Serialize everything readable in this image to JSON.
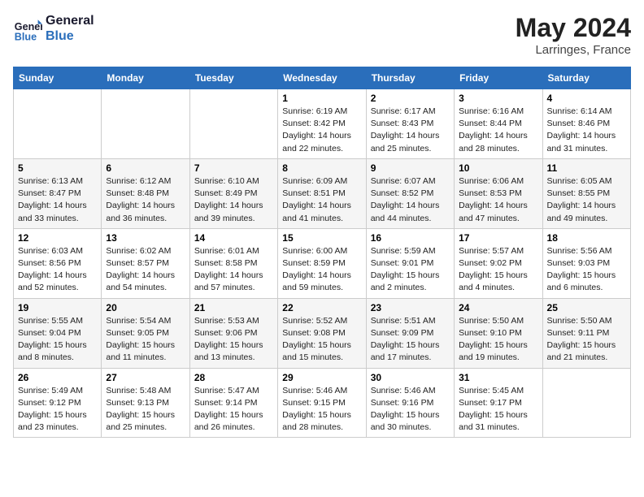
{
  "header": {
    "logo_line1": "General",
    "logo_line2": "Blue",
    "month_year": "May 2024",
    "location": "Larringes, France"
  },
  "weekdays": [
    "Sunday",
    "Monday",
    "Tuesday",
    "Wednesday",
    "Thursday",
    "Friday",
    "Saturday"
  ],
  "weeks": [
    [
      {
        "day": "",
        "info": ""
      },
      {
        "day": "",
        "info": ""
      },
      {
        "day": "",
        "info": ""
      },
      {
        "day": "1",
        "info": "Sunrise: 6:19 AM\nSunset: 8:42 PM\nDaylight: 14 hours\nand 22 minutes."
      },
      {
        "day": "2",
        "info": "Sunrise: 6:17 AM\nSunset: 8:43 PM\nDaylight: 14 hours\nand 25 minutes."
      },
      {
        "day": "3",
        "info": "Sunrise: 6:16 AM\nSunset: 8:44 PM\nDaylight: 14 hours\nand 28 minutes."
      },
      {
        "day": "4",
        "info": "Sunrise: 6:14 AM\nSunset: 8:46 PM\nDaylight: 14 hours\nand 31 minutes."
      }
    ],
    [
      {
        "day": "5",
        "info": "Sunrise: 6:13 AM\nSunset: 8:47 PM\nDaylight: 14 hours\nand 33 minutes."
      },
      {
        "day": "6",
        "info": "Sunrise: 6:12 AM\nSunset: 8:48 PM\nDaylight: 14 hours\nand 36 minutes."
      },
      {
        "day": "7",
        "info": "Sunrise: 6:10 AM\nSunset: 8:49 PM\nDaylight: 14 hours\nand 39 minutes."
      },
      {
        "day": "8",
        "info": "Sunrise: 6:09 AM\nSunset: 8:51 PM\nDaylight: 14 hours\nand 41 minutes."
      },
      {
        "day": "9",
        "info": "Sunrise: 6:07 AM\nSunset: 8:52 PM\nDaylight: 14 hours\nand 44 minutes."
      },
      {
        "day": "10",
        "info": "Sunrise: 6:06 AM\nSunset: 8:53 PM\nDaylight: 14 hours\nand 47 minutes."
      },
      {
        "day": "11",
        "info": "Sunrise: 6:05 AM\nSunset: 8:55 PM\nDaylight: 14 hours\nand 49 minutes."
      }
    ],
    [
      {
        "day": "12",
        "info": "Sunrise: 6:03 AM\nSunset: 8:56 PM\nDaylight: 14 hours\nand 52 minutes."
      },
      {
        "day": "13",
        "info": "Sunrise: 6:02 AM\nSunset: 8:57 PM\nDaylight: 14 hours\nand 54 minutes."
      },
      {
        "day": "14",
        "info": "Sunrise: 6:01 AM\nSunset: 8:58 PM\nDaylight: 14 hours\nand 57 minutes."
      },
      {
        "day": "15",
        "info": "Sunrise: 6:00 AM\nSunset: 8:59 PM\nDaylight: 14 hours\nand 59 minutes."
      },
      {
        "day": "16",
        "info": "Sunrise: 5:59 AM\nSunset: 9:01 PM\nDaylight: 15 hours\nand 2 minutes."
      },
      {
        "day": "17",
        "info": "Sunrise: 5:57 AM\nSunset: 9:02 PM\nDaylight: 15 hours\nand 4 minutes."
      },
      {
        "day": "18",
        "info": "Sunrise: 5:56 AM\nSunset: 9:03 PM\nDaylight: 15 hours\nand 6 minutes."
      }
    ],
    [
      {
        "day": "19",
        "info": "Sunrise: 5:55 AM\nSunset: 9:04 PM\nDaylight: 15 hours\nand 8 minutes."
      },
      {
        "day": "20",
        "info": "Sunrise: 5:54 AM\nSunset: 9:05 PM\nDaylight: 15 hours\nand 11 minutes."
      },
      {
        "day": "21",
        "info": "Sunrise: 5:53 AM\nSunset: 9:06 PM\nDaylight: 15 hours\nand 13 minutes."
      },
      {
        "day": "22",
        "info": "Sunrise: 5:52 AM\nSunset: 9:08 PM\nDaylight: 15 hours\nand 15 minutes."
      },
      {
        "day": "23",
        "info": "Sunrise: 5:51 AM\nSunset: 9:09 PM\nDaylight: 15 hours\nand 17 minutes."
      },
      {
        "day": "24",
        "info": "Sunrise: 5:50 AM\nSunset: 9:10 PM\nDaylight: 15 hours\nand 19 minutes."
      },
      {
        "day": "25",
        "info": "Sunrise: 5:50 AM\nSunset: 9:11 PM\nDaylight: 15 hours\nand 21 minutes."
      }
    ],
    [
      {
        "day": "26",
        "info": "Sunrise: 5:49 AM\nSunset: 9:12 PM\nDaylight: 15 hours\nand 23 minutes."
      },
      {
        "day": "27",
        "info": "Sunrise: 5:48 AM\nSunset: 9:13 PM\nDaylight: 15 hours\nand 25 minutes."
      },
      {
        "day": "28",
        "info": "Sunrise: 5:47 AM\nSunset: 9:14 PM\nDaylight: 15 hours\nand 26 minutes."
      },
      {
        "day": "29",
        "info": "Sunrise: 5:46 AM\nSunset: 9:15 PM\nDaylight: 15 hours\nand 28 minutes."
      },
      {
        "day": "30",
        "info": "Sunrise: 5:46 AM\nSunset: 9:16 PM\nDaylight: 15 hours\nand 30 minutes."
      },
      {
        "day": "31",
        "info": "Sunrise: 5:45 AM\nSunset: 9:17 PM\nDaylight: 15 hours\nand 31 minutes."
      },
      {
        "day": "",
        "info": ""
      }
    ]
  ]
}
